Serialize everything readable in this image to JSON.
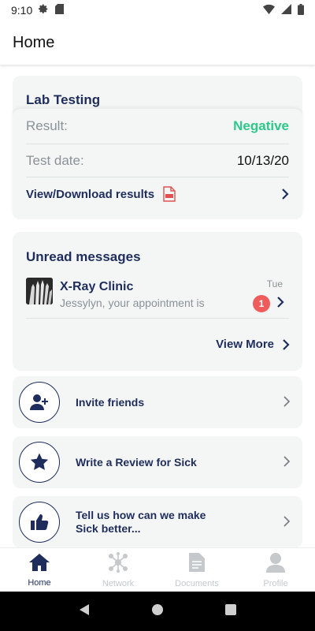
{
  "status_bar": {
    "time": "9:10"
  },
  "header": {
    "title": "Home"
  },
  "lab": {
    "title": "Lab Testing",
    "result_label": "Result:",
    "result_value": "Negative",
    "date_label": "Test date:",
    "date_value": "10/13/20",
    "download_label": "View/Download results"
  },
  "messages": {
    "title": "Unread messages",
    "items": [
      {
        "sender": "X-Ray Clinic",
        "preview": "Jessylyn, your appointment is",
        "time": "Tue",
        "badge": "1"
      }
    ],
    "view_more": "View More"
  },
  "actions": [
    {
      "label": "Invite friends",
      "icon": "add-user-icon"
    },
    {
      "label": "Write a Review for Sick",
      "icon": "star-icon"
    },
    {
      "label_line1": "Tell us how can we make",
      "label_line2": "Sick better...",
      "icon": "thumbs-up-icon"
    }
  ],
  "bottom_nav": [
    {
      "label": "Home",
      "icon": "home-icon",
      "active": true
    },
    {
      "label": "Network",
      "icon": "network-icon"
    },
    {
      "label": "Documents",
      "icon": "document-icon"
    },
    {
      "label": "Profile",
      "icon": "profile-icon"
    }
  ],
  "colors": {
    "navy": "#1f2d5c",
    "positive": "#2dc88a",
    "badge": "#f05c5c",
    "card": "#f4f6f6",
    "muted": "#8b9196"
  }
}
